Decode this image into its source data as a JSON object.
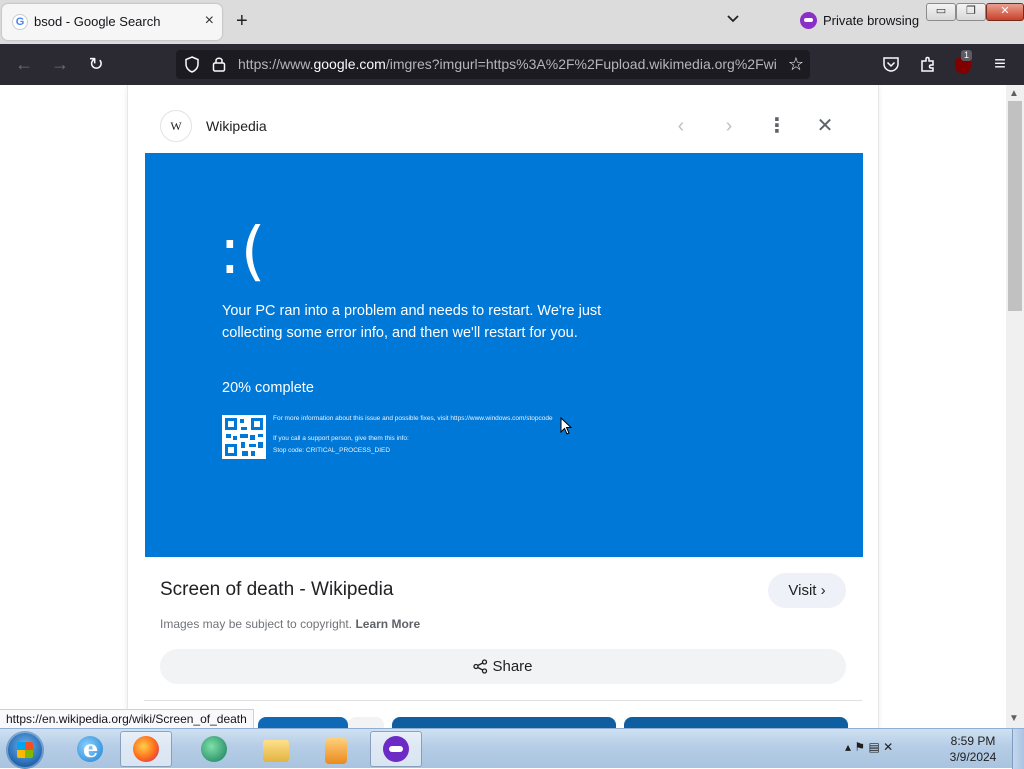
{
  "browser": {
    "tab_title": "bsod - Google Search",
    "new_tab": "+",
    "private_label": "Private browsing",
    "url_prefix": "https://www.",
    "url_domain": "google.com",
    "url_suffix": "/imgres?imgurl=https%3A%2F%2Fupload.wikimedia.org%2Fwiki",
    "extension_badge": "1",
    "status_url": "https://en.wikipedia.org/wiki/Screen_of_death"
  },
  "viewer": {
    "source_icon_text": "W",
    "source_name": "Wikipedia",
    "result_title": "Screen of death - Wikipedia",
    "visit_label": "Visit",
    "copyright_text": "Images may be subject to copyright.",
    "learn_more": "Learn More",
    "share_label": "Share"
  },
  "bsod": {
    "face": ":(",
    "message": "Your PC ran into a problem and needs to restart. We're just collecting some error info, and then we'll restart for you.",
    "progress": "20% complete",
    "info_line1": "For more information about this issue and possible fixes, visit https://www.windows.com/stopcode",
    "info_line2": "If you call a support person, give them this info:",
    "info_line3": "Stop code: CRITICAL_PROCESS_DIED",
    "background_color": "#0078d7"
  },
  "taskbar": {
    "time": "8:59 PM",
    "date": "3/9/2024"
  },
  "icons": {
    "tab_favicon": "G",
    "tab_close": "×",
    "tablist": "chevron-down-icon",
    "back": "←",
    "forward": "→",
    "reload": "↻",
    "star": "☆",
    "prev": "‹",
    "next": "›",
    "more": "⋮",
    "close_viewer": "✕",
    "visit_chevron": "›",
    "app_menu": "≡",
    "scroll_up": "▲",
    "scroll_down": "▼",
    "win_min": "▭",
    "win_max": "❐",
    "win_close": "✕",
    "tray": "▴ ⚑ ▤ ✕"
  }
}
